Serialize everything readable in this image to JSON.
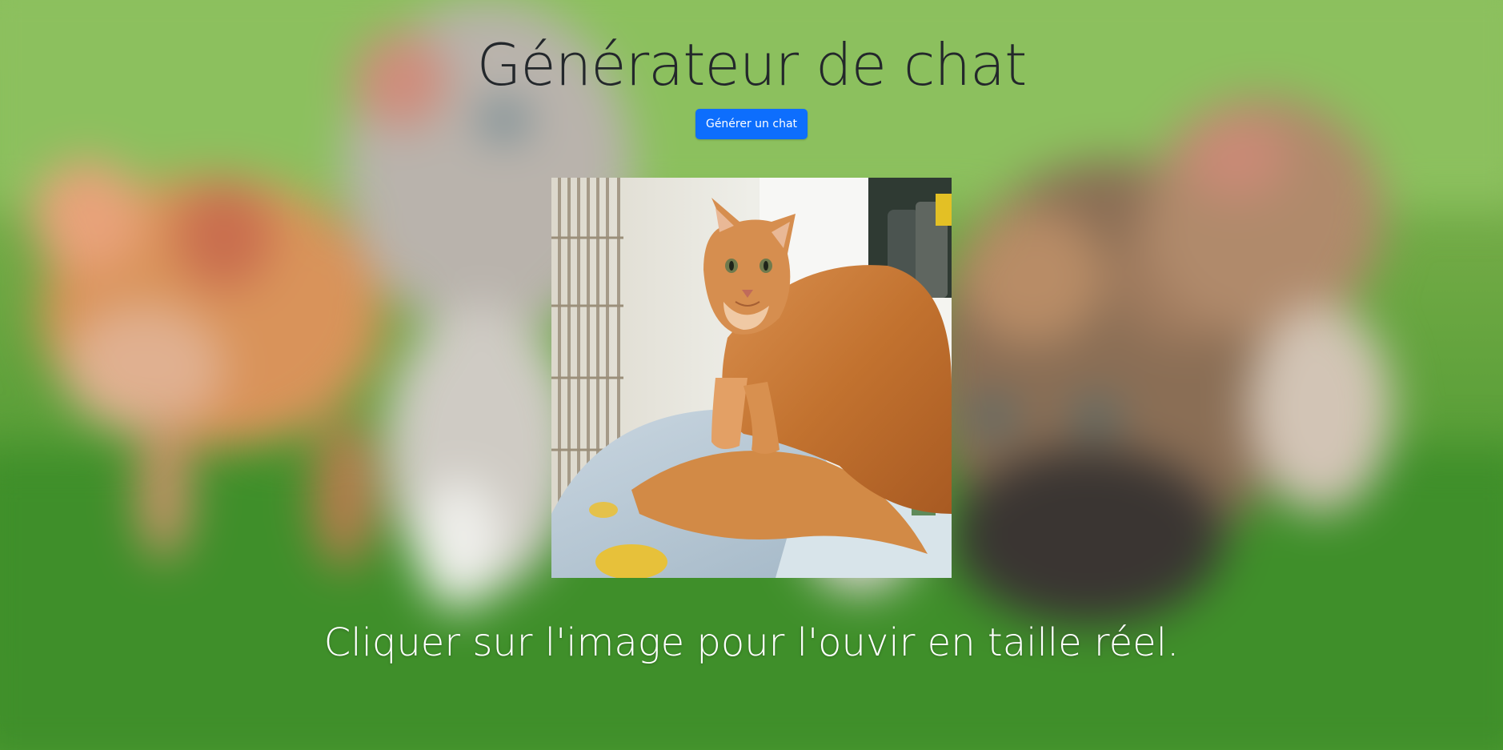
{
  "page": {
    "title": "Générateur de chat",
    "generate_button_label": "Générer un chat",
    "caption": "Cliquer sur l'image pour l'ouvir en taille réel."
  },
  "colors": {
    "button_bg": "#0d6efd",
    "title_text": "#23272b",
    "caption_text": "#ffffff"
  }
}
